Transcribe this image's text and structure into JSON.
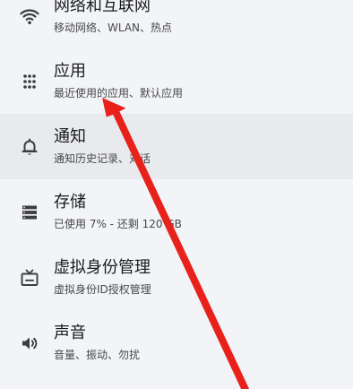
{
  "settings": {
    "items": [
      {
        "icon": "wifi-icon",
        "title": "网络和互联网",
        "subtitle": "移动网络、WLAN、热点"
      },
      {
        "icon": "apps-grid-icon",
        "title": "应用",
        "subtitle": "最近使用的应用、默认应用"
      },
      {
        "icon": "bell-icon",
        "title": "通知",
        "subtitle": "通知历史记录、对话"
      },
      {
        "icon": "storage-icon",
        "title": "存储",
        "subtitle": "已使用 7% - 还剩 120 GB"
      },
      {
        "icon": "tv-icon",
        "title": "虚拟身份管理",
        "subtitle": "虚拟身份ID授权管理"
      },
      {
        "icon": "volume-icon",
        "title": "声音",
        "subtitle": "音量、振动、勿扰"
      }
    ]
  },
  "colors": {
    "background": "#f3f4f7",
    "highlight_row": "#e9eaee",
    "title_text": "#1a1b1f",
    "subtitle_text": "#47484d",
    "icon": "#3c3d42",
    "annotation_arrow": "#e8221b"
  },
  "annotation": {
    "type": "arrow",
    "points_to": "应用"
  }
}
